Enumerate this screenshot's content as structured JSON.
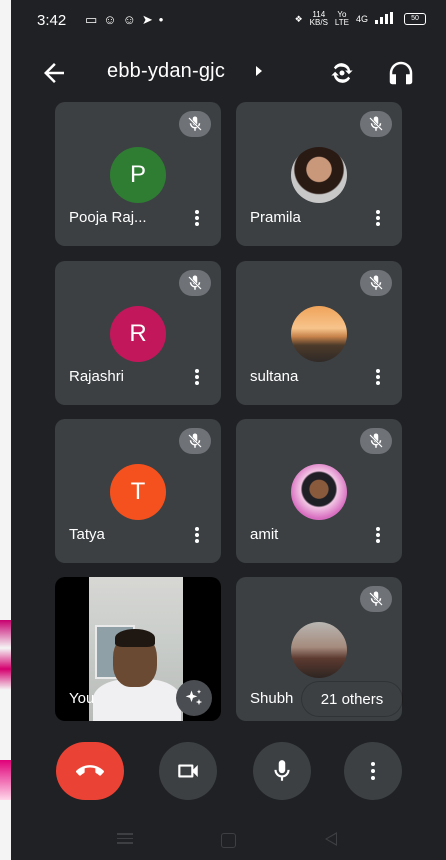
{
  "status_bar": {
    "time": "3:42",
    "network_speed": "114",
    "network_speed_unit": "KB/S",
    "volte_top": "Yo",
    "volte_bottom": "LTE",
    "network_type": "4G",
    "battery": "50"
  },
  "header": {
    "meeting_code": "ebb-ydan-gjc"
  },
  "participants": [
    {
      "name": "Pooja Raj...",
      "initial": "P",
      "color": "#2e7d32",
      "muted": true
    },
    {
      "name": "Pramila",
      "initial": "",
      "avatar": "photo",
      "muted": true
    },
    {
      "name": "Rajashri",
      "initial": "R",
      "color": "#c2185b",
      "muted": true
    },
    {
      "name": "sultana",
      "initial": "",
      "avatar": "photo",
      "muted": true
    },
    {
      "name": "Tatya",
      "initial": "T",
      "color": "#f4511e",
      "muted": true
    },
    {
      "name": "amit",
      "initial": "",
      "avatar": "photo",
      "muted": true
    }
  ],
  "self_tile": {
    "name": "You"
  },
  "others_tile": {
    "name": "Shubh",
    "others_count_label": "21 others"
  },
  "icons": {
    "back": "arrow-left-icon",
    "switch_camera": "switch-camera-icon",
    "audio": "headphones-icon",
    "muted": "mic-off-icon",
    "more": "more-vert-icon",
    "effects": "sparkle-icon",
    "end_call": "phone-hangup-icon",
    "video": "videocam-icon",
    "mic": "mic-icon"
  },
  "colors": {
    "background": "#202124",
    "tile": "#3c4043",
    "end_call": "#ea4335"
  }
}
